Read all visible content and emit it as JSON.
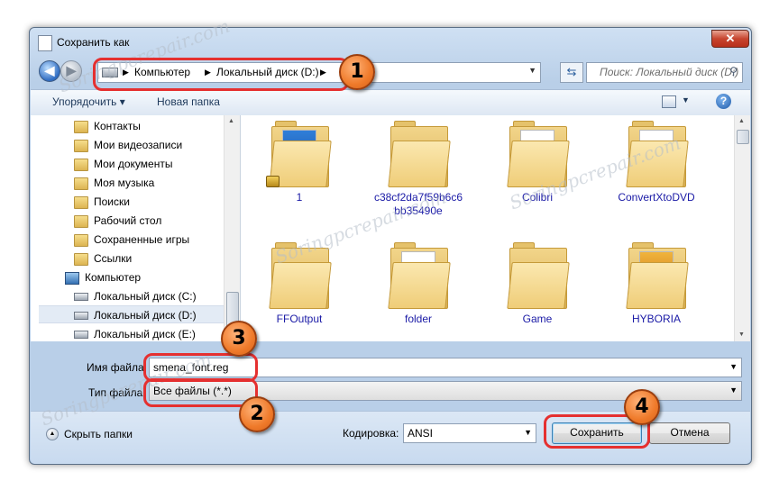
{
  "window": {
    "title": "Сохранить как",
    "close_label": "✕"
  },
  "nav": {
    "address_parts": [
      "Компьютер",
      "Локальный диск (D:)"
    ],
    "search_placeholder": "Поиск: Локальный диск (D:)"
  },
  "toolbar": {
    "organize_label": "Упорядочить ▾",
    "new_folder_label": "Новая папка",
    "help_label": "?"
  },
  "tree": {
    "items": [
      {
        "label": "Контакты",
        "icon": "folder"
      },
      {
        "label": "Мои видеозаписи",
        "icon": "folder"
      },
      {
        "label": "Мои документы",
        "icon": "folder"
      },
      {
        "label": "Моя музыка",
        "icon": "folder"
      },
      {
        "label": "Поиски",
        "icon": "folder"
      },
      {
        "label": "Рабочий стол",
        "icon": "folder"
      },
      {
        "label": "Сохраненные игры",
        "icon": "folder"
      },
      {
        "label": "Ссылки",
        "icon": "folder"
      },
      {
        "label": "Компьютер",
        "icon": "computer"
      },
      {
        "label": "Локальный диск (C:)",
        "icon": "drive"
      },
      {
        "label": "Локальный диск (D:)",
        "icon": "drive",
        "selected": true
      },
      {
        "label": "Локальный диск (E:)",
        "icon": "drive"
      }
    ]
  },
  "files": {
    "items": [
      {
        "label": "1",
        "locked": true
      },
      {
        "label": "c38cf2da7f59b6c6bb35490e"
      },
      {
        "label": "Colibri"
      },
      {
        "label": "ConvertXtoDVD"
      },
      {
        "label": "FFOutput"
      },
      {
        "label": "folder"
      },
      {
        "label": "Game"
      },
      {
        "label": "HYBORIA"
      }
    ]
  },
  "form": {
    "filename_label": "Имя файла:",
    "filename_value": "smena_font.reg",
    "filetype_label": "Тип файла:",
    "filetype_value": "Все файлы  (*.*)",
    "hide_folders_label": "Скрыть папки",
    "encoding_label": "Кодировка:",
    "encoding_value": "ANSI",
    "save_label": "Сохранить",
    "cancel_label": "Отмена"
  },
  "annotations": {
    "badge1": "1",
    "badge2": "2",
    "badge3": "3",
    "badge4": "4"
  },
  "watermark": "Soringpcrepair.com",
  "colors": {
    "annotation_red": "#e53030",
    "badge_orange": "#ef7a2a",
    "link_blue": "#1a1aa6"
  }
}
